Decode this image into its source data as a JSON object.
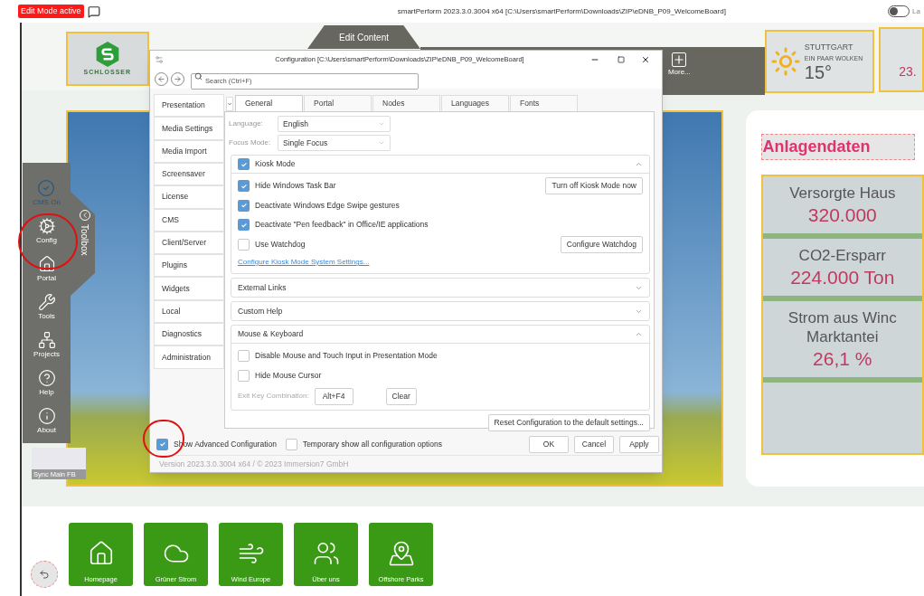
{
  "app": {
    "edit_badge": "Edit Mode active",
    "title": "smartPerform 2023.3.0.3004 x64 [C:\\Users\\smartPerform\\Downloads\\ZIP\\eDNB_P09_WelcomeBoard]",
    "toggle": {
      "on": false,
      "label": "La"
    }
  },
  "header": {
    "logo_text": "SCHLOSSER",
    "edit_tab": "Edit Content",
    "more_button": "More...",
    "weather": {
      "city": "STUTTGART",
      "condition": "EIN PAAR WOLKEN",
      "temperature": "15°"
    },
    "side_value": "23."
  },
  "toolbox": {
    "label": "Toolbox",
    "items": [
      {
        "kind": "cms",
        "label": "CMS On",
        "active": true
      },
      {
        "kind": "config",
        "label": "Config",
        "active": false
      },
      {
        "kind": "portal",
        "label": "Portal",
        "active": false
      },
      {
        "kind": "tools",
        "label": "Tools",
        "active": false
      },
      {
        "kind": "projects",
        "label": "Projects",
        "active": false
      },
      {
        "kind": "help",
        "label": "Help",
        "active": false
      },
      {
        "kind": "about",
        "label": "About",
        "active": false
      }
    ]
  },
  "sync_widget": {
    "label": "Sync Main FB"
  },
  "panel": {
    "title": "Anlagendaten",
    "stats": [
      {
        "label_lines": [
          "Versorgte Haus"
        ],
        "value": "320.000"
      },
      {
        "label_lines": [
          "CO2-Ersparr"
        ],
        "value": "224.000 Ton"
      },
      {
        "label_lines": [
          "Strom aus Winc",
          "Marktantei"
        ],
        "value": "26,1 %"
      }
    ]
  },
  "tiles": [
    {
      "kind": "home",
      "label": "Homepage"
    },
    {
      "kind": "cloud",
      "label": "Grüner Strom"
    },
    {
      "kind": "wind",
      "label": "Wind Europe"
    },
    {
      "kind": "people",
      "label": "Über uns"
    },
    {
      "kind": "map",
      "label": "Offshore Parks"
    }
  ],
  "dialog": {
    "title": "Configuration [C:\\Users\\smartPerform\\Downloads\\ZIP\\eDNB_P09_WelcomeBoard]",
    "search": {
      "placeholder": "Search (Ctrl+F)"
    },
    "nav": [
      "Presentation",
      "Media Settings",
      "Media Import",
      "Screensaver",
      "License",
      "CMS",
      "Client/Server",
      "Plugins",
      "Widgets",
      "Local",
      "Diagnostics",
      "Administration"
    ],
    "tabs": [
      {
        "label": "General",
        "selected": true
      },
      {
        "label": "Portal",
        "selected": false
      },
      {
        "label": "Nodes",
        "selected": false
      },
      {
        "label": "Languages",
        "selected": false
      },
      {
        "label": "Fonts",
        "selected": false
      }
    ],
    "fields": [
      {
        "label": "Language:",
        "value": "English"
      },
      {
        "label": "Focus Mode:",
        "value": "Single Focus"
      }
    ],
    "sections": [
      {
        "kind": "checkbox",
        "title": "Kiosk Mode",
        "checked": true,
        "expanded": true,
        "rows": [
          {
            "kind": "checkbox",
            "label": "Hide Windows Task Bar",
            "checked": true,
            "button": "Turn off Kiosk Mode now"
          },
          {
            "kind": "checkbox",
            "label": "Deactivate Windows Edge Swipe gestures",
            "checked": true
          },
          {
            "kind": "checkbox",
            "label": "Deactivate \"Pen feedback\" in Office/IE applications",
            "checked": true
          },
          {
            "kind": "checkbox",
            "label": "Use Watchdog",
            "checked": false,
            "button": "Configure Watchdog"
          },
          {
            "kind": "link",
            "label": "Configure Kiosk Mode System Settings..."
          }
        ]
      },
      {
        "kind": "plain",
        "title": "External Links",
        "expanded": false
      },
      {
        "kind": "plain",
        "title": "Custom Help",
        "expanded": false
      },
      {
        "kind": "plain",
        "title": "Mouse & Keyboard",
        "expanded": true,
        "rows": [
          {
            "kind": "checkbox",
            "label": "Disable Mouse and Touch Input in Presentation Mode",
            "checked": false
          },
          {
            "kind": "checkbox",
            "label": "Hide Mouse Cursor",
            "checked": false
          },
          {
            "kind": "keys",
            "label": "Exit Key Combination:",
            "value": "Alt+F4",
            "button": "Clear"
          }
        ]
      }
    ],
    "reset_button": "Reset Configuration to the default settings...",
    "options": [
      {
        "label": "Show Advanced Configuration",
        "checked": true
      },
      {
        "label": "Temporary show all configuration options",
        "checked": false
      }
    ],
    "buttons": [
      "OK",
      "Cancel",
      "Apply"
    ],
    "version": "Version 2023.3.0.3004 x64 / © 2023 Immersion7 GmbH"
  }
}
